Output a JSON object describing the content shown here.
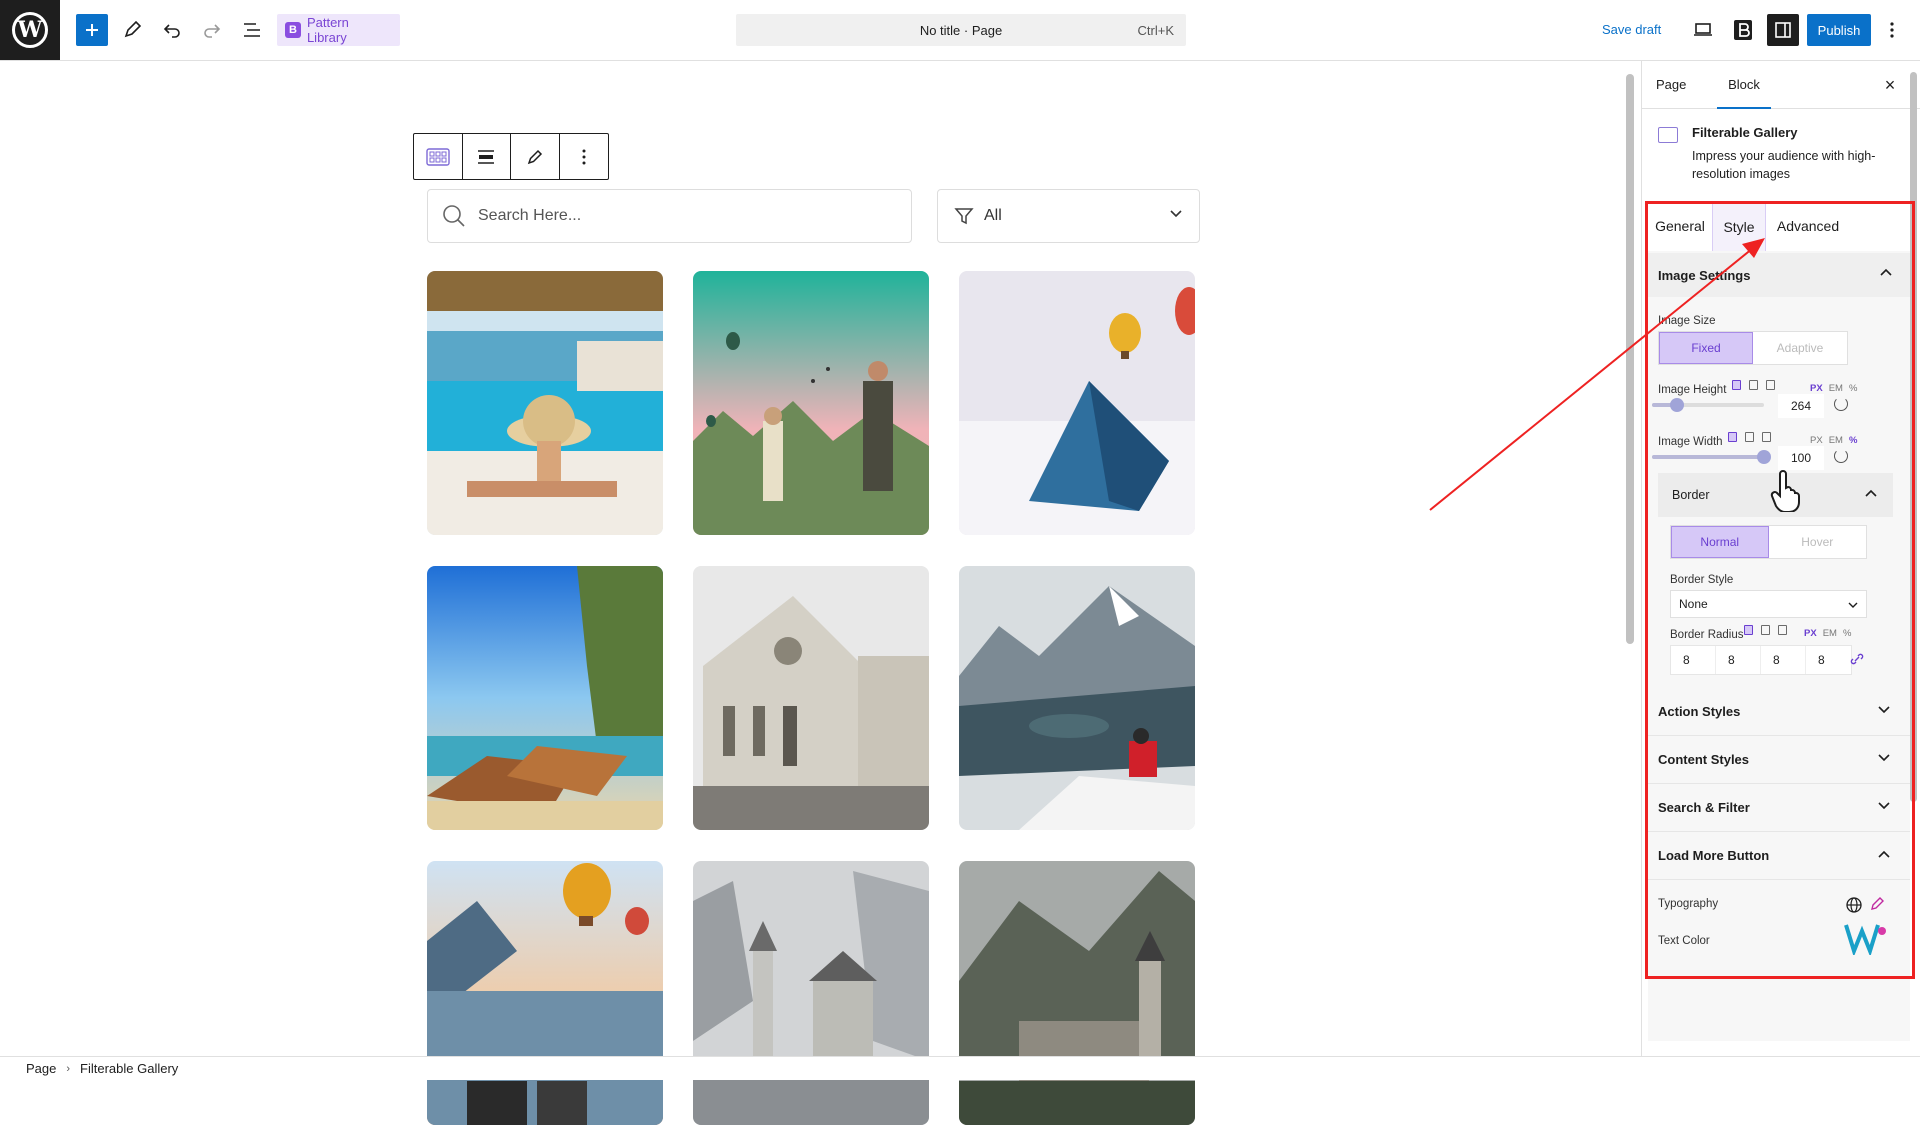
{
  "topbar": {
    "pattern_library": "Pattern Library",
    "page_title": "No title · Page",
    "shortcut": "Ctrl+K",
    "save_draft": "Save draft",
    "publish": "Publish"
  },
  "canvas": {
    "search_placeholder": "Search Here...",
    "filter_value": "All"
  },
  "gallery": {
    "items": [
      "resort pool",
      "hot air balloons valley",
      "tent in snow",
      "longtail boats",
      "stone cathedral",
      "snowy mountain lake",
      "balloons over sea",
      "castle in fog",
      "castle in mountains"
    ]
  },
  "breadcrumb": {
    "root": "Page",
    "current": "Filterable Gallery"
  },
  "sidebar": {
    "tab_page": "Page",
    "tab_block": "Block",
    "close": "×",
    "block_title": "Filterable Gallery",
    "block_desc": "Impress your audience with high-resolution images",
    "tabs": {
      "general": "General",
      "style": "Style",
      "advanced": "Advanced"
    },
    "image_settings": {
      "title": "Image Settings",
      "image_size_label": "Image Size",
      "fixed": "Fixed",
      "adaptive": "Adaptive",
      "height_label": "Image Height",
      "height_value": "264",
      "height_fraction": 0.22,
      "width_label": "Image Width",
      "width_value": "100",
      "width_fraction": 1.0,
      "units": [
        "PX",
        "EM",
        "%"
      ]
    },
    "border": {
      "title": "Border",
      "normal": "Normal",
      "hover": "Hover",
      "style_label": "Border Style",
      "style_value": "None",
      "radius_label": "Border Radius",
      "radius": [
        "8",
        "8",
        "8",
        "8"
      ]
    },
    "sections": [
      "Action Styles",
      "Content Styles",
      "Search & Filter",
      "Load More Button"
    ],
    "typography_label": "Typography",
    "text_color_label": "Text Color"
  },
  "colors": {
    "accent": "#0a71c9",
    "highlight": "#ee2222",
    "purple": "#6a3fd0"
  }
}
